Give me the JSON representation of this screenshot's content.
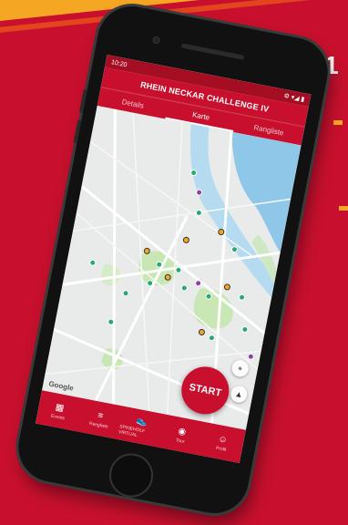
{
  "background": {
    "number": "1"
  },
  "statusbar": {
    "time": "10:20",
    "icons": "⚙ ▾◢ ▮"
  },
  "app": {
    "title": "RHEIN NECKAR CHALLENGE IV"
  },
  "tabs": [
    {
      "label": "Details"
    },
    {
      "label": "Karte"
    },
    {
      "label": "Rangliste"
    }
  ],
  "map": {
    "start_label": "START",
    "attribution": "Google"
  },
  "bottom_nav": [
    {
      "label": "Events",
      "icon": "calendar-icon"
    },
    {
      "label": "Rangliste",
      "icon": "list-icon"
    },
    {
      "label": "SPINEHOLF VIRTUAL",
      "icon": "shoe-icon"
    },
    {
      "label": "Tour",
      "icon": "tour-icon"
    },
    {
      "label": "Profil",
      "icon": "profile-icon"
    }
  ],
  "colors": {
    "brand": "#c8102e",
    "accent": "#f5a623",
    "marker_green": "#2aa876",
    "marker_purple": "#8e3fa6"
  }
}
